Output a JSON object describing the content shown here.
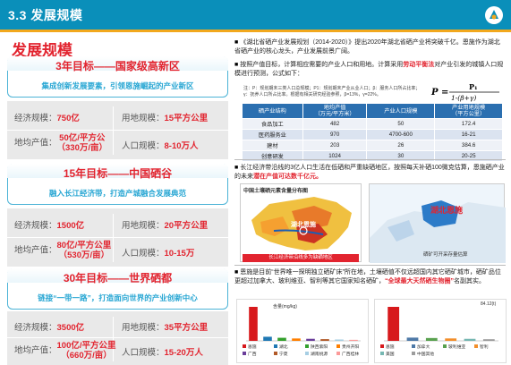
{
  "header": {
    "title": "3.3  发展规模"
  },
  "main_title": "发展规模",
  "goals": [
    {
      "title": "3年目标——国家级高新区",
      "subtitle": "集成创新发展要素，引领恩施崛起的产业新区",
      "econ_label": "经济规模：",
      "econ_value": "750亿",
      "land_label": "用地规模：",
      "land_value": "15平方公里",
      "gdp_label": "地均产值：",
      "gdp_value1": "50亿/平方公",
      "gdp_value2": "（330万/亩）",
      "pop_label": "人口规模：",
      "pop_value": "8-10万人"
    },
    {
      "title": "15年目标——中国硒谷",
      "subtitle": "融入长江经济带，打造产城融合发展典范",
      "econ_label": "经济规模：",
      "econ_value": "1500亿",
      "land_label": "用地规模：",
      "land_value": "20平方公里",
      "gdp_label": "地均产值：",
      "gdp_value1": "80亿/平方公里",
      "gdp_value2": "（530万/亩）",
      "pop_label": "人口规模：",
      "pop_value": "10-15万"
    },
    {
      "title": "30年目标——世界硒都",
      "subtitle": "链接“一带一路”，打造面向世界的产业创新中心",
      "econ_label": "经济规模：",
      "econ_value": "3500亿",
      "land_label": "用地规模：",
      "land_value": "35平方公里",
      "gdp_label": "地均产值：",
      "gdp_value1": "100亿/平方公里",
      "gdp_value2": "（660万/亩）",
      "pop_label": "人口规模：",
      "pop_value": "15-20万人"
    }
  ],
  "right": {
    "p1": "《湖北省硒产业发展规划（2014-2020）》提出2020年湖北省硒产业将突破千亿。恩施作为湖北省硒产业的核心龙头，产业发展前景广阔。",
    "p2a": "按照产值目标，计算相应需要的产业人口和用地。计算采用",
    "p2b": "劳动平衡法",
    "p2c": "对产业引发的城镇人口规模进行预测，公式如下：",
    "formula_note": "注：P：规划期末三类人口总规模；P1：规划期末产业从业人口；β：服务人口所占比率；γ：抚养人口所占比率。根据有相关研究经验参照，β=13%，γ=22%。",
    "formula": "P = P₁ / (1-(β+γ))",
    "table_headers": [
      "硒产业结构",
      "地均产值\n（万元/平方米）",
      "地均产值（万元/平方米）",
      "产业人口规模",
      "产业用地规模\n（平方公里）"
    ],
    "table_rows": [
      [
        "食品加工",
        "482",
        "50",
        "172.4"
      ],
      [
        "医药服务业",
        "970",
        "4700-600",
        "16-21"
      ],
      [
        "建材",
        "203",
        "26",
        "384.6"
      ],
      [
        "创意研发",
        "1024",
        "30",
        "20-25"
      ]
    ],
    "p3a": "长江经济带沿线的3亿人口生活在低硒和严重缺硒地区，按照每天补硒100微克估算，恩施硒产业的未来",
    "p3b": "潜在产值可达数千亿元。",
    "map1_title": "中国土壤硒元素含量分布图",
    "map1_label": "湖北恩施",
    "map1_footer": "长江经济带沿线多为缺硒地区",
    "map2_label": "湖北恩施",
    "map2_legend": "硒矿可开采存量估算",
    "p4a": "恩施是目前“世界唯一探明独立硒矿床”所在地，土壤硒值不仅远超国内其它硒矿城市，硒矿品位更超过加拿大、玻利维亚、智利等其它国家知名硒矿，",
    "p4b": "“全球最大天然硒生物圈”",
    "p4c": "名副其实。",
    "chart1_unit": "含量(mg/kg)",
    "chart2_value": "84.12(t)",
    "legend1": [
      "恩施",
      "湖北",
      "陕西紫阳",
      "贵州开阳",
      "广西",
      "宁夏",
      "湖南桃源",
      "广西桂林"
    ],
    "legend2": [
      "恩施",
      "加拿大",
      "玻利维亚",
      "智利",
      "美国",
      "中国其他"
    ]
  },
  "chart_data": [
    {
      "type": "bar",
      "title": "",
      "ylabel": "含量(mg/kg)",
      "categories": [
        "恩施",
        "湖北",
        "陕西紫阳",
        "贵州开阳",
        "广西",
        "宁夏",
        "湖南桃源",
        "广西桂林"
      ],
      "values": [
        100,
        12,
        9,
        7,
        6,
        5,
        4,
        3
      ]
    },
    {
      "type": "bar",
      "title": "",
      "categories": [
        "恩施",
        "加拿大",
        "玻利维亚",
        "智利",
        "美国",
        "中国其他"
      ],
      "values": [
        84.12,
        8,
        7,
        6,
        5,
        4
      ]
    }
  ],
  "colors": {
    "header": "#0a8fba",
    "accent_red": "#e2242f",
    "stripe": "#f2a81d",
    "subtitle_blue": "#27a6d3"
  }
}
